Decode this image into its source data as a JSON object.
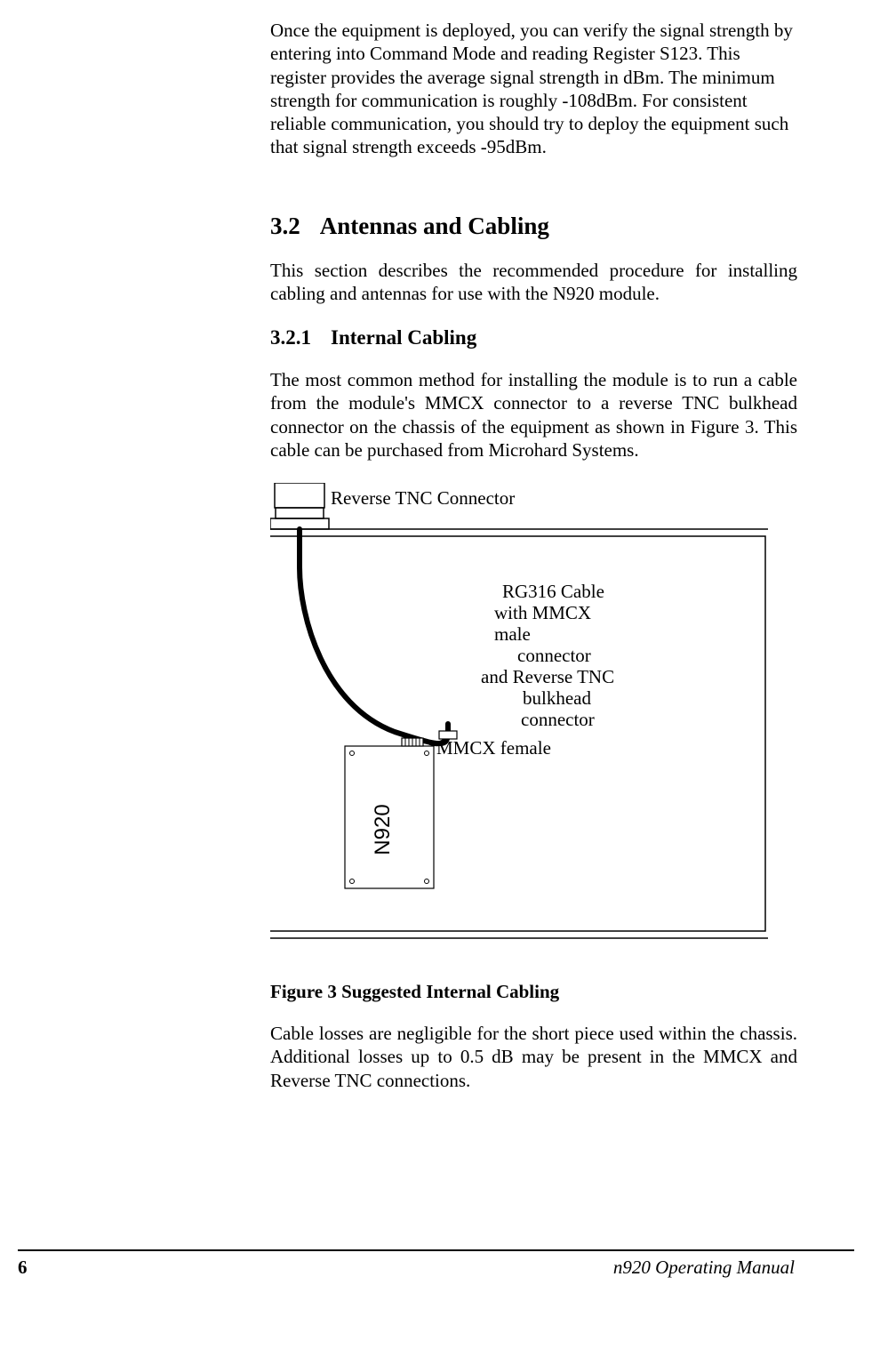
{
  "body": {
    "intro": "Once the equipment is deployed, you can verify the signal strength by entering into Command Mode and reading Register S123.  This register provides the average signal strength in dBm.  The minimum strength for communication is roughly -108dBm.  For consistent reliable communication, you should try to deploy the equipment such that signal strength exceeds -95dBm.",
    "h2_num": "3.2",
    "h2_title": "Antennas and Cabling",
    "sec32_p1": "This section describes the recommended procedure for installing cabling and antennas for use with the N920 module.",
    "h3_num": "3.2.1",
    "h3_title": "Internal Cabling",
    "sec321_p1": "The most common method for installing the module is to run a cable from the module's MMCX connector to a reverse TNC bulkhead connector on the chassis of the equipment as shown in Figure 3.  This cable can be purchased from Microhard Systems.",
    "fig_caption": "Figure 3 Suggested Internal Cabling",
    "sec321_p2": "Cable losses are negligible for the short piece used within the chassis. Additional losses up to 0.5 dB may be present in the MMCX and Reverse TNC connections."
  },
  "diagram": {
    "rev_tnc": "Reverse TNC Connector",
    "cable_l1": "RG316 Cable",
    "cable_l2": "with MMCX",
    "cable_l3": "male",
    "cable_l4": "connector",
    "cable_l5": "and Reverse TNC",
    "cable_l6": "bulkhead",
    "cable_l7": "connector",
    "mmcx_female": "MMCX female",
    "module": "N920"
  },
  "footer": {
    "page": "6",
    "title": "n920 Operating Manual"
  }
}
